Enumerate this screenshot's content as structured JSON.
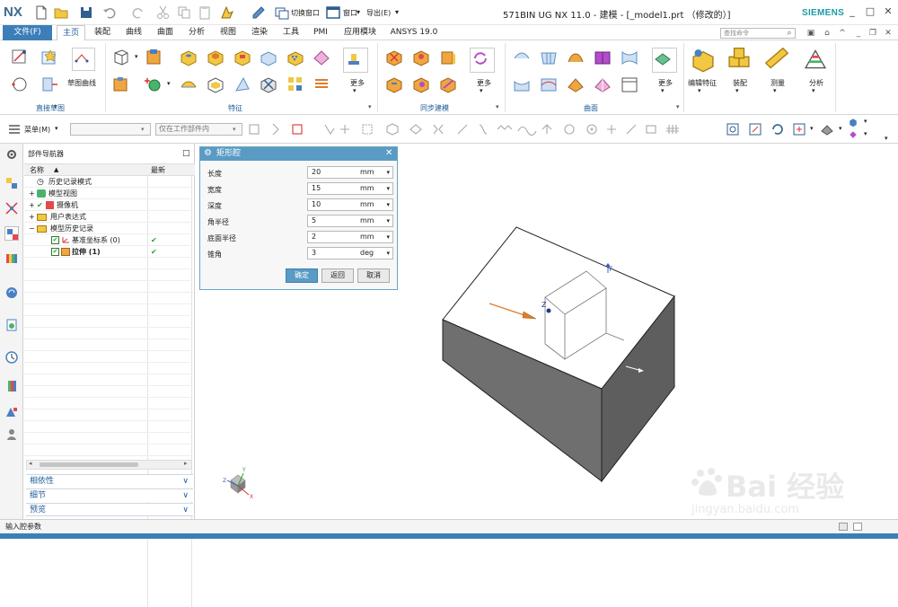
{
  "app": {
    "logo": "NX",
    "title": "571BIN UG NX 11.0 - 建模 - [_model1.prt （修改的）]",
    "brand": "SIEMENS",
    "switch_window": "切换窗口",
    "window_menu": "窗口",
    "export_menu": "导出(E)"
  },
  "menu": {
    "file_tab": "文件(F)",
    "tabs": [
      "主页",
      "装配",
      "曲线",
      "曲面",
      "分析",
      "视图",
      "渲染",
      "工具",
      "PMI",
      "应用模块",
      "ANSYS 19.0"
    ],
    "active_tab": "主页",
    "search_placeholder": "查找命令"
  },
  "ribbon": {
    "groups": [
      "直接草图",
      "特征",
      "同步建模",
      "曲面"
    ],
    "labels": {
      "sketch_curve": "草图曲线",
      "more1": "更多",
      "more2": "更多",
      "more3": "更多",
      "edit_feature": "编辑特征",
      "assembly": "装配",
      "measure": "测量",
      "analysis": "分析"
    }
  },
  "toolbar2": {
    "menu_button": "菜单(M)",
    "filter_combo": "",
    "scope_combo": "仅在工作部件内"
  },
  "navigator": {
    "title": "部件导航器",
    "col_name": "名称",
    "col_latest": "最新",
    "rows": [
      {
        "label": "历史记录模式",
        "indent": 0,
        "check": ""
      },
      {
        "label": "模型视图",
        "indent": 0,
        "check": ""
      },
      {
        "label": "摄像机",
        "indent": 0,
        "check": ""
      },
      {
        "label": "用户表达式",
        "indent": 0,
        "check": ""
      },
      {
        "label": "模型历史记录",
        "indent": 0,
        "check": ""
      },
      {
        "label": "基准坐标系 (0)",
        "indent": 1,
        "check": "✔"
      },
      {
        "label": "拉伸 (1)",
        "indent": 1,
        "check": "✔"
      }
    ],
    "panels": [
      "相依性",
      "细节",
      "预览"
    ]
  },
  "dialog": {
    "title": "矩形腔",
    "params": [
      {
        "label": "长度",
        "value": "20",
        "unit": "mm"
      },
      {
        "label": "宽度",
        "value": "15",
        "unit": "mm"
      },
      {
        "label": "深度",
        "value": "10",
        "unit": "mm"
      },
      {
        "label": "角半径",
        "value": "5",
        "unit": "mm"
      },
      {
        "label": "底面半径",
        "value": "2",
        "unit": "mm"
      },
      {
        "label": "锥角",
        "value": "3",
        "unit": "deg"
      }
    ],
    "ok": "确定",
    "back": "返回",
    "cancel": "取消"
  },
  "viewport": {
    "axis_y": "Y",
    "axis_z": "Z",
    "triad_x": "X",
    "triad_y": "Y",
    "triad_z": "Z"
  },
  "status": {
    "prompt": "输入腔参数"
  },
  "watermark": {
    "main": "Bai 经验",
    "sub": "jingyan.baidu.com"
  },
  "colors": {
    "accent": "#3c7fb8",
    "dialog_title": "#5a9bc4",
    "group_label": "#1e5c9a",
    "ok_button": "#5a9bc4",
    "check": "#2aa32a"
  }
}
